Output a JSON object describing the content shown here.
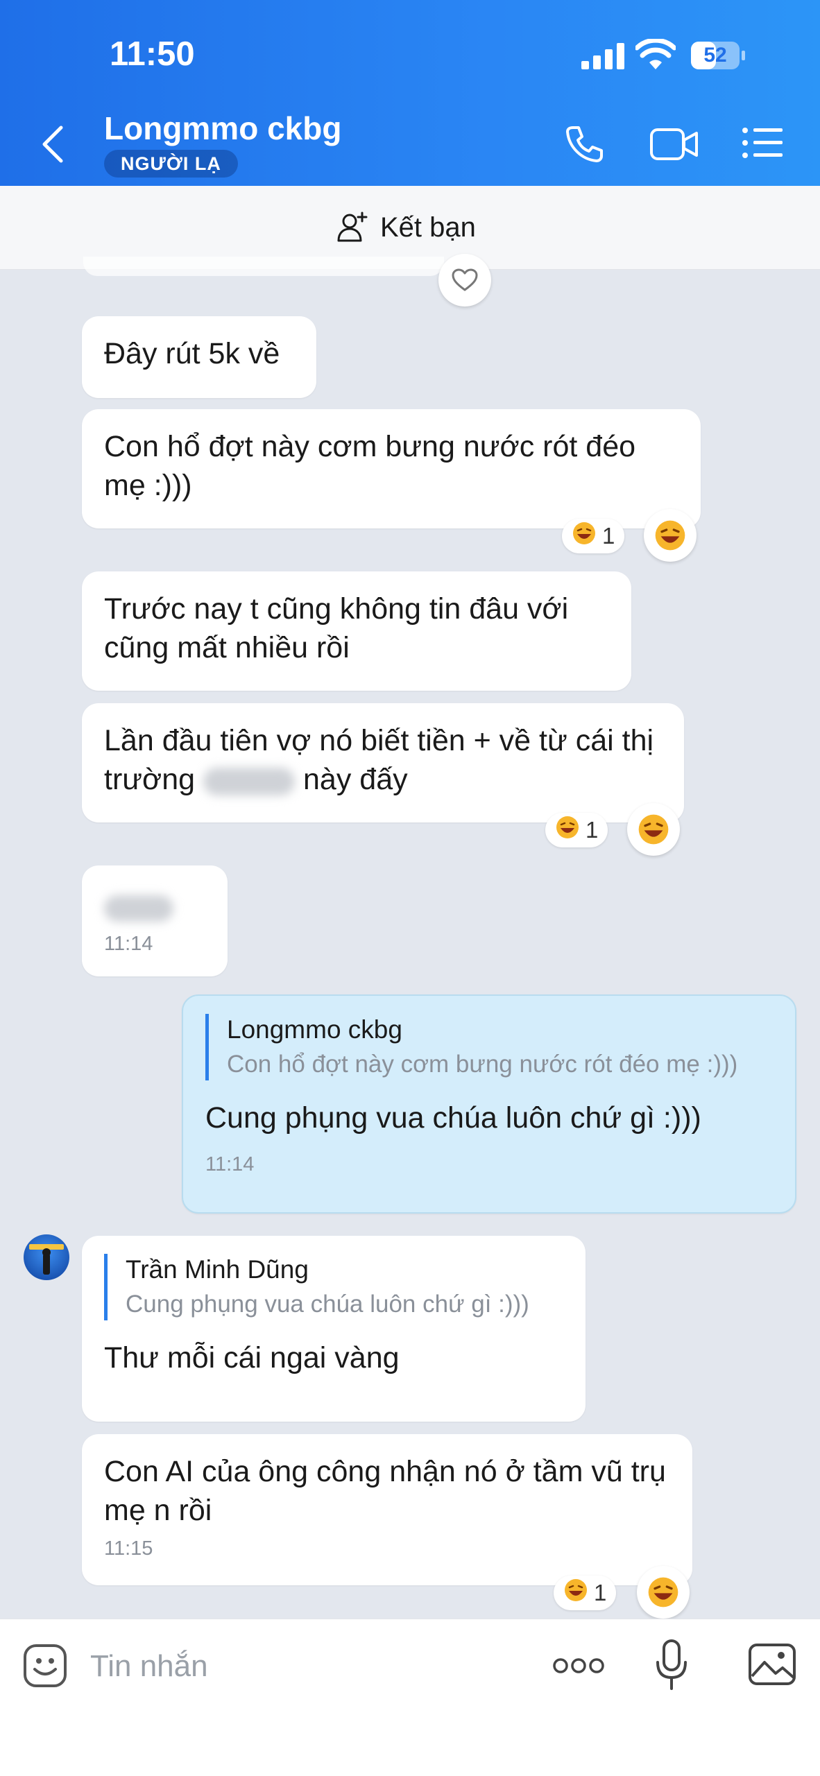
{
  "status_bar": {
    "time": "11:50",
    "battery": "52",
    "battery_level": 0.52
  },
  "header": {
    "title": "Longmmo ckbg",
    "badge": "NGƯỜI LẠ"
  },
  "friend_bar": {
    "label": "Kết bạn"
  },
  "messages": [
    {
      "text": "Đây rút 5k về"
    },
    {
      "text": "Con hổ đợt này cơm bưng nước rót đéo mẹ :)))",
      "reaction_count": "1"
    },
    {
      "text": "Trước nay t cũng không tin đâu với cũng mất nhiều rồi"
    },
    {
      "text_before": "Lần đầu tiên vợ nó biết tiền + về từ cái thị trường",
      "text_after": "này đấy",
      "reaction_count": "1"
    },
    {
      "time": "11:14"
    },
    {
      "quote_name": "Longmmo ckbg",
      "quote_text": "Con hổ đợt này cơm bưng nước rót đéo mẹ :)))",
      "text": "Cung phụng vua chúa luôn chứ gì :)))",
      "time": "11:14"
    },
    {
      "quote_name": "Trần Minh Dũng",
      "quote_text": "Cung phụng vua chúa luôn chứ gì :)))",
      "text": "Thư mỗi cái ngai vàng"
    },
    {
      "text": "Con AI của ông công nhận nó ở tầm vũ trụ mẹ n rồi",
      "time": "11:15",
      "reaction_count": "1"
    }
  ],
  "input": {
    "placeholder": "Tin nhắn"
  },
  "colors": {
    "header_blue": "#1f6fe8",
    "sent_bubble": "#d4edfb",
    "quote_bar": "#2a7fea",
    "background": "#e3e7ee"
  }
}
